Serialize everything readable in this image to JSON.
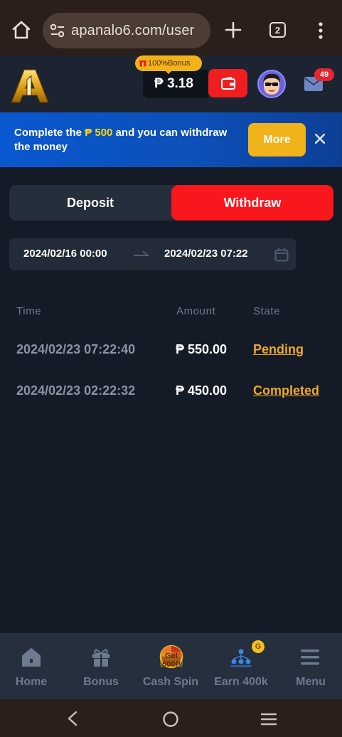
{
  "browser": {
    "url": "apanalo6.com/user",
    "tab_count": "2"
  },
  "header": {
    "bonus_badge": "100%Bonus",
    "balance": "₱ 3.18",
    "mail_count": "49"
  },
  "promo": {
    "text_before": "Complete the ",
    "highlight": "₱ 500",
    "text_after": " and you can withdraw the money",
    "more_label": "More"
  },
  "tabs": {
    "deposit_label": "Deposit",
    "withdraw_label": "Withdraw",
    "active": "Withdraw"
  },
  "date_range": {
    "start": "2024/02/16 00:00",
    "end": "2024/02/23 07:22"
  },
  "table": {
    "headers": {
      "time": "Time",
      "amount": "Amount",
      "state": "State"
    },
    "rows": [
      {
        "time": "2024/02/23 07:22:40",
        "amount": "₱ 550.00",
        "state": "Pending"
      },
      {
        "time": "2024/02/23 02:22:32",
        "amount": "₱ 450.00",
        "state": "Completed"
      }
    ]
  },
  "bottom_nav": {
    "home": "Home",
    "bonus": "Bonus",
    "cash_spin": "Cash Spin",
    "cash_spin_badge_line1": "Get",
    "cash_spin_badge_line2": "500P",
    "earn": "Earn 400k",
    "earn_badge": "G",
    "menu": "Menu"
  },
  "colors": {
    "accent_red": "#f8171d",
    "accent_gold": "#f0b31a",
    "state_link": "#f0a82a",
    "background": "#141b26",
    "promo_blue": "#0a58d0"
  }
}
